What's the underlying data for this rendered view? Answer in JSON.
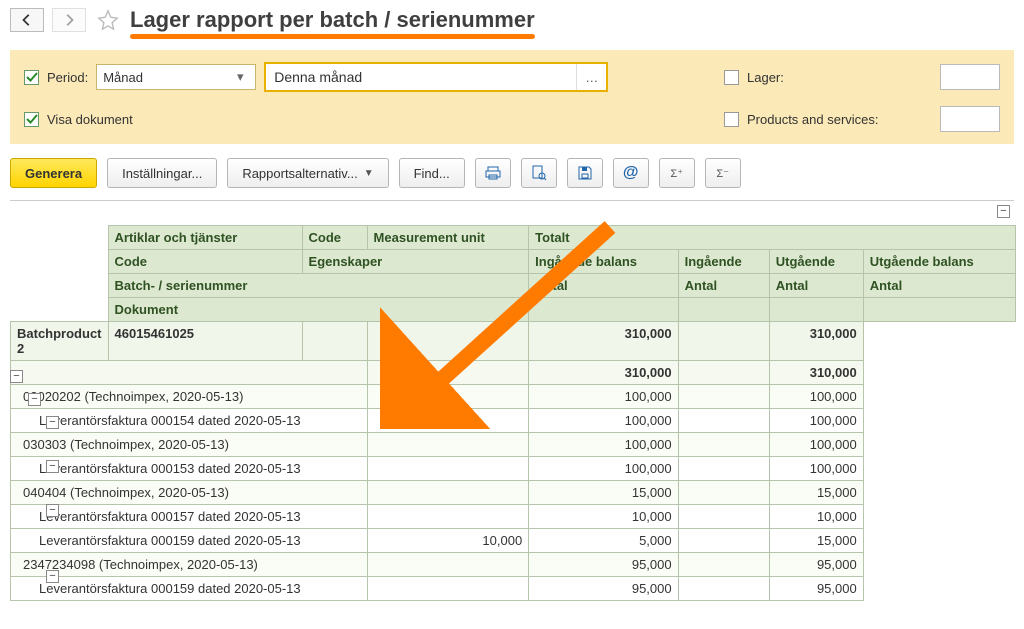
{
  "title": "Lager rapport per batch / serienummer",
  "filters": {
    "period_label": "Period:",
    "period_mode": "Månad",
    "period_value": "Denna månad",
    "show_documents_label": "Visa dokument",
    "lager_label": "Lager:",
    "products_label": "Products and services:"
  },
  "toolbar": {
    "generate": "Generera",
    "settings": "Inställningar...",
    "report_options": "Rapportsalternativ...",
    "find": "Find..."
  },
  "headers": {
    "articles": "Artiklar och tjänster",
    "code": "Code",
    "unit": "Measurement unit",
    "total": "Totalt",
    "code2": "Code",
    "properties": "Egenskaper",
    "in_balance": "Ingående balans",
    "ingaende": "Ingående",
    "utgaende": "Utgående",
    "out_balance": "Utgående balans",
    "batch": "Batch- / serienummer",
    "document": "Dokument",
    "antal": "Antal"
  },
  "rows": [
    {
      "level": 1,
      "label": "Batchproduct 2",
      "code": "46015461025",
      "in": "",
      "ingaende": "310,000",
      "ut": "",
      "out": "310,000"
    },
    {
      "level": 2,
      "label": "",
      "in": "",
      "ingaende": "310,000",
      "ut": "",
      "out": "310,000"
    },
    {
      "level": 3,
      "label": "02020202 (Technoimpex, 2020-05-13)",
      "in": "",
      "ingaende": "100,000",
      "ut": "",
      "out": "100,000"
    },
    {
      "level": 4,
      "label": "Leverantörsfaktura 000154 dated 2020-05-13",
      "in": "",
      "ingaende": "100,000",
      "ut": "",
      "out": "100,000"
    },
    {
      "level": 3,
      "label": "030303 (Technoimpex, 2020-05-13)",
      "in": "",
      "ingaende": "100,000",
      "ut": "",
      "out": "100,000"
    },
    {
      "level": 4,
      "label": "Leverantörsfaktura 000153 dated 2020-05-13",
      "in": "",
      "ingaende": "100,000",
      "ut": "",
      "out": "100,000"
    },
    {
      "level": 3,
      "label": "040404 (Technoimpex, 2020-05-13)",
      "in": "",
      "ingaende": "15,000",
      "ut": "",
      "out": "15,000"
    },
    {
      "level": 4,
      "label": "Leverantörsfaktura 000157 dated 2020-05-13",
      "in": "",
      "ingaende": "10,000",
      "ut": "",
      "out": "10,000"
    },
    {
      "level": 4,
      "label": "Leverantörsfaktura 000159 dated 2020-05-13",
      "in": "10,000",
      "ingaende": "5,000",
      "ut": "",
      "out": "15,000"
    },
    {
      "level": 3,
      "label": "2347234098 (Technoimpex, 2020-05-13)",
      "in": "",
      "ingaende": "95,000",
      "ut": "",
      "out": "95,000"
    },
    {
      "level": 4,
      "label": "Leverantörsfaktura 000159 dated 2020-05-13",
      "in": "",
      "ingaende": "95,000",
      "ut": "",
      "out": "95,000"
    }
  ]
}
